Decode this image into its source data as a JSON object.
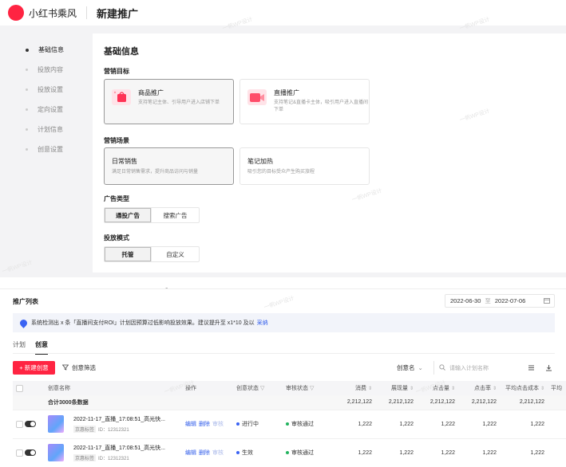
{
  "app": {
    "brand": "小红书乘风",
    "page_title": "新建推广"
  },
  "sidebar": {
    "items": [
      {
        "label": "基础信息",
        "active": true
      },
      {
        "label": "投放内容",
        "active": false
      },
      {
        "label": "投放设置",
        "active": false
      },
      {
        "label": "定向设置",
        "active": false
      },
      {
        "label": "计划信息",
        "active": false
      },
      {
        "label": "创意设置",
        "active": false
      }
    ]
  },
  "form": {
    "section_title": "基础信息",
    "goal": {
      "label": "营销目标",
      "options": [
        {
          "title": "商品推广",
          "desc": "支持笔记主体、引导用户进入店铺下单",
          "selected": true,
          "icon": "shopping-bag-icon",
          "color": "#ff3355"
        },
        {
          "title": "直播推广",
          "desc": "支持笔记&直播卡主体，吸引用户进入直播间下单",
          "selected": false,
          "icon": "live-camera-icon",
          "color": "#ff4d6a"
        }
      ]
    },
    "scene": {
      "label": "营销场景",
      "options": [
        {
          "title": "日常销售",
          "desc": "满足日常销售需求，提升商品访问与销量",
          "selected": true
        },
        {
          "title": "笔记加热",
          "desc": "吸引您的目标受众产生购买旅程",
          "selected": false
        }
      ]
    },
    "ad_type": {
      "label": "广告类型",
      "options": [
        "通投广告",
        "搜索广告"
      ],
      "active": 0
    },
    "delivery_mode": {
      "label": "投放模式",
      "options": [
        "托管",
        "自定义"
      ],
      "active": 0
    }
  },
  "watermark": "一帆WP设计",
  "list": {
    "title": "推广列表",
    "date_start": "2022-06-30",
    "date_sep": "至",
    "date_end": "2022-07-06",
    "alert": {
      "text": "系统检测出 x 条「直播间支付ROI」计划因预算过低影响投放效果。建议提升至 x1*10 及以",
      "link": "采纳"
    },
    "tabs": [
      {
        "label": "计划",
        "active": false
      },
      {
        "label": "创意",
        "active": true
      }
    ],
    "new_button": "+ 新建创意",
    "filter_button": "创意筛选",
    "select_label": "创意名",
    "search_placeholder": "请输入计划名称",
    "columns": {
      "name": "创意名称",
      "ops": "操作",
      "creative_status": "创意状态",
      "review_status": "审核状态",
      "spend": "消费",
      "impressions": "展现量",
      "clicks": "点击量",
      "ctr": "点击率",
      "cpc": "平均点击成本",
      "more": "平均"
    },
    "summary": {
      "label": "合计3000条数据",
      "spend": "2,212,122",
      "impressions": "2,212,122",
      "clicks": "2,212,122",
      "ctr": "2,212,122",
      "cpc": "2,212,122"
    },
    "rows": [
      {
        "title": "2022-11-17_直播_17:08:51_高光快...",
        "tag": "京惠标签",
        "id": "ID：12312321",
        "ops": [
          "编辑",
          "删除",
          "审核"
        ],
        "creative_status": "进行中",
        "creative_status_color": "#3a63f3",
        "review_status": "审核通过",
        "review_status_color": "#22b35e",
        "spend": "1,222",
        "impressions": "1,222",
        "clicks": "1,222",
        "ctr": "1,222",
        "cpc": "1,222"
      },
      {
        "title": "2022-11-17_直播_17:08:51_高光快...",
        "tag": "京惠标签",
        "id": "ID：12312321",
        "ops": [
          "编辑",
          "删除",
          "审核"
        ],
        "creative_status": "生效",
        "creative_status_color": "#3a63f3",
        "review_status": "审核通过",
        "review_status_color": "#22b35e",
        "spend": "1,222",
        "impressions": "1,222",
        "clicks": "1,222",
        "ctr": "1,222",
        "cpc": "1,222"
      }
    ]
  }
}
